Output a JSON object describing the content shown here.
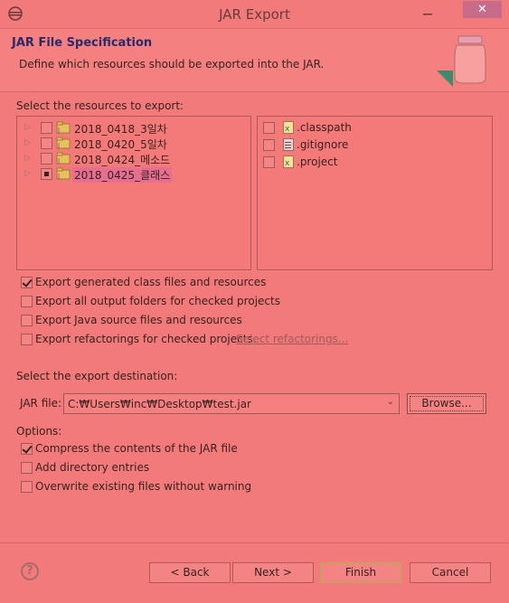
{
  "window": {
    "title": "JAR Export",
    "close_glyph": "✕",
    "minimize_glyph": "—"
  },
  "header": {
    "title": "JAR File Specification",
    "description": "Define which resources should be exported into the JAR."
  },
  "resources": {
    "label": "Select the resources to export:",
    "projects": [
      {
        "name": "2018_0418_3일차",
        "checked": false,
        "selected": false
      },
      {
        "name": "2018_0420_5일차",
        "checked": false,
        "selected": false
      },
      {
        "name": "2018_0424_메소드",
        "checked": false,
        "selected": false
      },
      {
        "name": "2018_0425_클래스",
        "checked": "partial",
        "selected": true
      }
    ],
    "files": [
      {
        "name": ".classpath",
        "icon": "xml-file-icon",
        "checked": false
      },
      {
        "name": ".gitignore",
        "icon": "text-file-icon",
        "checked": false
      },
      {
        "name": ".project",
        "icon": "xml-file-icon",
        "checked": false
      }
    ]
  },
  "options_top": [
    {
      "label": "Export generated class files and resources",
      "checked": true
    },
    {
      "label": "Export all output folders for checked projects",
      "checked": false
    },
    {
      "label": "Export Java source files and resources",
      "checked": false
    },
    {
      "label": "Export refactorings for checked projects.",
      "checked": false
    }
  ],
  "select_refactorings_link": "Select refactorings...",
  "destination": {
    "label": "Select the export destination:",
    "jar_file_label": "JAR file:",
    "jar_file_value": "C:₩Users₩inc₩Desktop₩test.jar",
    "browse_label": "Browse..."
  },
  "options": {
    "label": "Options:",
    "items": [
      {
        "label": "Compress the contents of the JAR file",
        "checked": true
      },
      {
        "label": "Add directory entries",
        "checked": false
      },
      {
        "label": "Overwrite existing files without warning",
        "checked": false
      }
    ]
  },
  "footer": {
    "help_glyph": "?",
    "back_label": "< Back",
    "next_label": "Next >",
    "finish_label": "Finish",
    "cancel_label": "Cancel"
  },
  "colors": {
    "accent": "#f27a7a",
    "selection": "#e66f90",
    "header_title": "#2a2a6a"
  }
}
